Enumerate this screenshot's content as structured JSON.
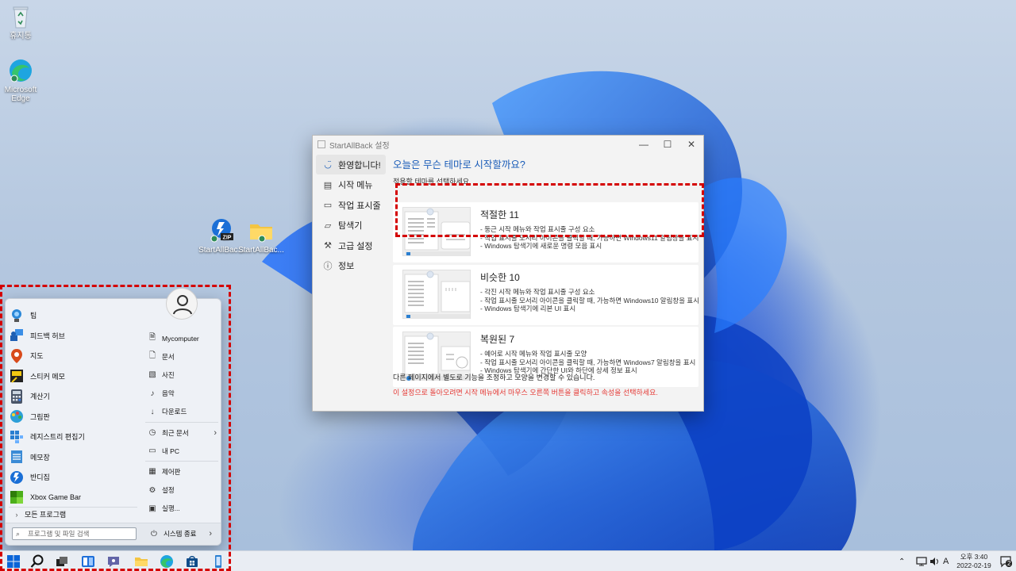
{
  "desktop": {
    "icons": [
      {
        "label": "휴지통"
      },
      {
        "label": "Microsoft Edge"
      },
      {
        "label": "StartAllBac..."
      },
      {
        "label": "StartAllBac..."
      }
    ]
  },
  "settings_window": {
    "title": "StartAllBack 설정",
    "controls": {
      "minimize": "—",
      "maximize": "☐",
      "close": "✕"
    },
    "nav": [
      {
        "label": "환영합니다!",
        "icon": "smile-icon",
        "active": true
      },
      {
        "label": "시작 메뉴",
        "icon": "start-menu-icon"
      },
      {
        "label": "작업 표시줄",
        "icon": "taskbar-icon"
      },
      {
        "label": "탐색기",
        "icon": "folder-icon"
      },
      {
        "label": "고급 설정",
        "icon": "wrench-icon"
      },
      {
        "label": "정보",
        "icon": "info-icon"
      }
    ],
    "heading": "오늘은 무슨 테마로 시작할까요?",
    "subheading": "적용할 테마를 선택하세요",
    "themes": [
      {
        "title": "적절한 11",
        "lines": [
          "- 둥근 시작 메뉴와 작업 표시줄 구성 요소",
          "- 작업 표시줄 모서리 아이콘을 클릭할 때, 가능하면 Windows11 알림창을 표시",
          "- Windows 탐색기에 새로운 명령 모음 표시"
        ]
      },
      {
        "title": "비슷한 10",
        "lines": [
          "- 각진 시작 메뉴와 작업 표시줄 구성 요소",
          "- 작업 표시줄 모서리 아이콘을 클릭할 때, 가능하면 Windows10 알림창을 표시",
          "- Windows 탐색기에 리본 UI 표시"
        ]
      },
      {
        "title": "복원된 7",
        "lines": [
          "- 예어로 시작 메뉴와 작업 표시줄 모양",
          "- 작업 표시줄 모서리 아이콘을 클릭할 때, 가능하면 Windows7 알림창을 표시",
          "- Windows 탐색기에 간단한 UI와 하단에 상세 정보 표시"
        ]
      }
    ],
    "footer_note": "다른 페이지에서 별도로 기능을 조정하고 모양을 변경할 수 있습니다.",
    "footer_warning": "이 설정으로 돌아오려면 시작 메뉴에서 마우스 오른쪽 버튼을 클릭하고 속성을 선택하세요."
  },
  "start_menu": {
    "apps": [
      {
        "label": "팁",
        "icon": "tips-icon",
        "color": "#2b88d8"
      },
      {
        "label": "피드백 허브",
        "icon": "feedback-icon",
        "color": "#1e5fb3"
      },
      {
        "label": "지도",
        "icon": "maps-icon",
        "color": "#d84a1b"
      },
      {
        "label": "스티커 메모",
        "icon": "sticky-notes-icon",
        "color": "#f2c811"
      },
      {
        "label": "계산기",
        "icon": "calculator-icon",
        "color": "#4a5568"
      },
      {
        "label": "그림판",
        "icon": "paint-icon",
        "color": "#2d9fd8"
      },
      {
        "label": "레지스트리 편집기",
        "icon": "registry-icon",
        "color": "#2a7fd1"
      },
      {
        "label": "메모장",
        "icon": "notepad-icon",
        "color": "#3b8bd6"
      },
      {
        "label": "반디집",
        "icon": "bandizip-icon",
        "color": "#1a6fd6"
      },
      {
        "label": "Xbox Game Bar",
        "icon": "xbox-icon",
        "color": "#4caf1a"
      }
    ],
    "all_programs": "모든 프로그램",
    "search_placeholder": "프로그램 및 파일 검색",
    "places": [
      {
        "label": "Mycomputer",
        "icon": "user-folder-icon",
        "glyph": "🗎"
      },
      {
        "label": "문서",
        "icon": "document-icon",
        "glyph": "🗋"
      },
      {
        "label": "사진",
        "icon": "picture-icon",
        "glyph": "▧"
      },
      {
        "label": "음악",
        "icon": "music-icon",
        "glyph": "♪"
      },
      {
        "label": "다운로드",
        "icon": "download-icon",
        "glyph": "↓"
      }
    ],
    "places2": [
      {
        "label": "최근 문서",
        "icon": "recent-icon",
        "glyph": "◷",
        "arrow": "›"
      }
    ],
    "places3": [
      {
        "label": "내 PC",
        "icon": "pc-icon",
        "glyph": "▭"
      }
    ],
    "places4": [
      {
        "label": "제어판",
        "icon": "control-panel-icon",
        "glyph": "▦"
      },
      {
        "label": "설정",
        "icon": "settings-gear-icon",
        "glyph": "⚙"
      },
      {
        "label": "실행...",
        "icon": "run-icon",
        "glyph": "▣"
      }
    ],
    "shutdown": "시스템 종료",
    "shutdown_arrow": "›"
  },
  "taskbar": {
    "tray": {
      "ime": "A"
    },
    "clock": {
      "time": "오후 3:40",
      "date": "2022-02-19"
    },
    "notification_count": "2"
  },
  "colors": {
    "accent": "#1a5cb8",
    "warning": "#e53935",
    "highlight": "#d40000"
  }
}
